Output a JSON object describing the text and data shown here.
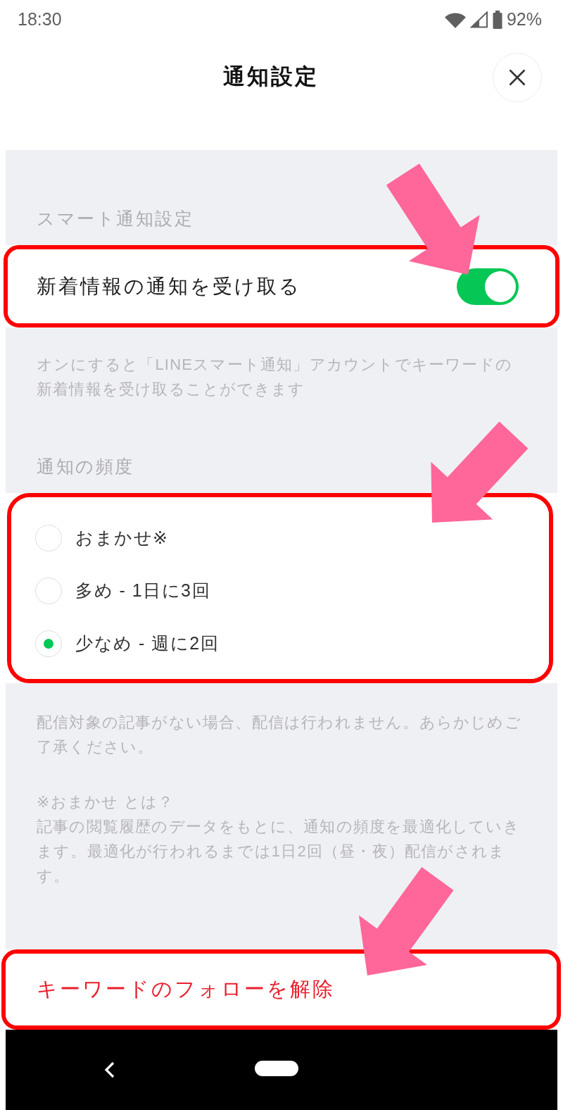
{
  "status_bar": {
    "time": "18:30",
    "battery": "92%"
  },
  "header": {
    "title": "通知設定"
  },
  "smart_notification": {
    "heading": "スマート通知設定",
    "highlighted": true,
    "arrow": true,
    "toggle": {
      "label": "新着情報の通知を受け取る",
      "on": true
    },
    "description": "オンにすると「LINEスマート通知」アカウントでキーワードの新着情報を受け取ることができます"
  },
  "frequency": {
    "heading": "通知の頻度",
    "highlighted": true,
    "arrow": true,
    "options": [
      {
        "label": "おまかせ※",
        "selected": false
      },
      {
        "label": "多め - 1日に3回",
        "selected": false
      },
      {
        "label": "少なめ - 週に2回",
        "selected": true
      }
    ],
    "notes": "配信対象の記事がない場合、配信は行われません。あらかじめご了承ください。",
    "help": {
      "title": "※おまかせ とは？",
      "body": "記事の閲覧履歴のデータをもとに、通知の頻度を最適化していきます。最適化が行われるまでは1日2回（昼・夜）配信がされます。"
    }
  },
  "unfollow": {
    "label": "キーワードのフォローを解除",
    "highlighted": true,
    "arrow": true
  }
}
